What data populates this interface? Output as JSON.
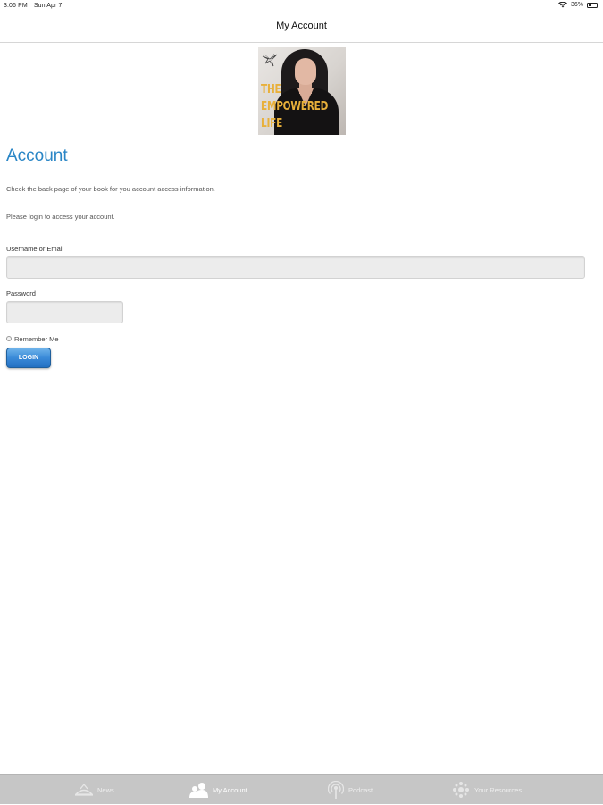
{
  "status_bar": {
    "time": "3:06 PM",
    "date": "Sun Apr 7",
    "battery": "36%",
    "battery_level_fraction": 0.36
  },
  "nav": {
    "title": "My Account"
  },
  "logo": {
    "lines": [
      "THE",
      "EMPOWERED",
      "LIFE"
    ],
    "icon": "bird-emblem-icon",
    "accent_color": "#e8b03a"
  },
  "account": {
    "title": "Account",
    "info_line_1": "Check the back page of your book for you account access information.",
    "info_line_2": "Please login to access your account.",
    "username_label": "Username or Email",
    "username_value": "",
    "password_label": "Password",
    "password_value": "",
    "remember_label": "Remember Me",
    "remember_checked": false,
    "login_label": "LOGIN",
    "title_color": "#2a86c6",
    "button_color": "#2f7fcf"
  },
  "tab_bar": {
    "tabs": [
      {
        "label": "News",
        "icon": "news-icon",
        "active": false
      },
      {
        "label": "My Account",
        "icon": "account-icon",
        "active": true
      },
      {
        "label": "Podcast",
        "icon": "podcast-icon",
        "active": false
      },
      {
        "label": "Your Resources",
        "icon": "resources-icon",
        "active": false
      }
    ]
  }
}
